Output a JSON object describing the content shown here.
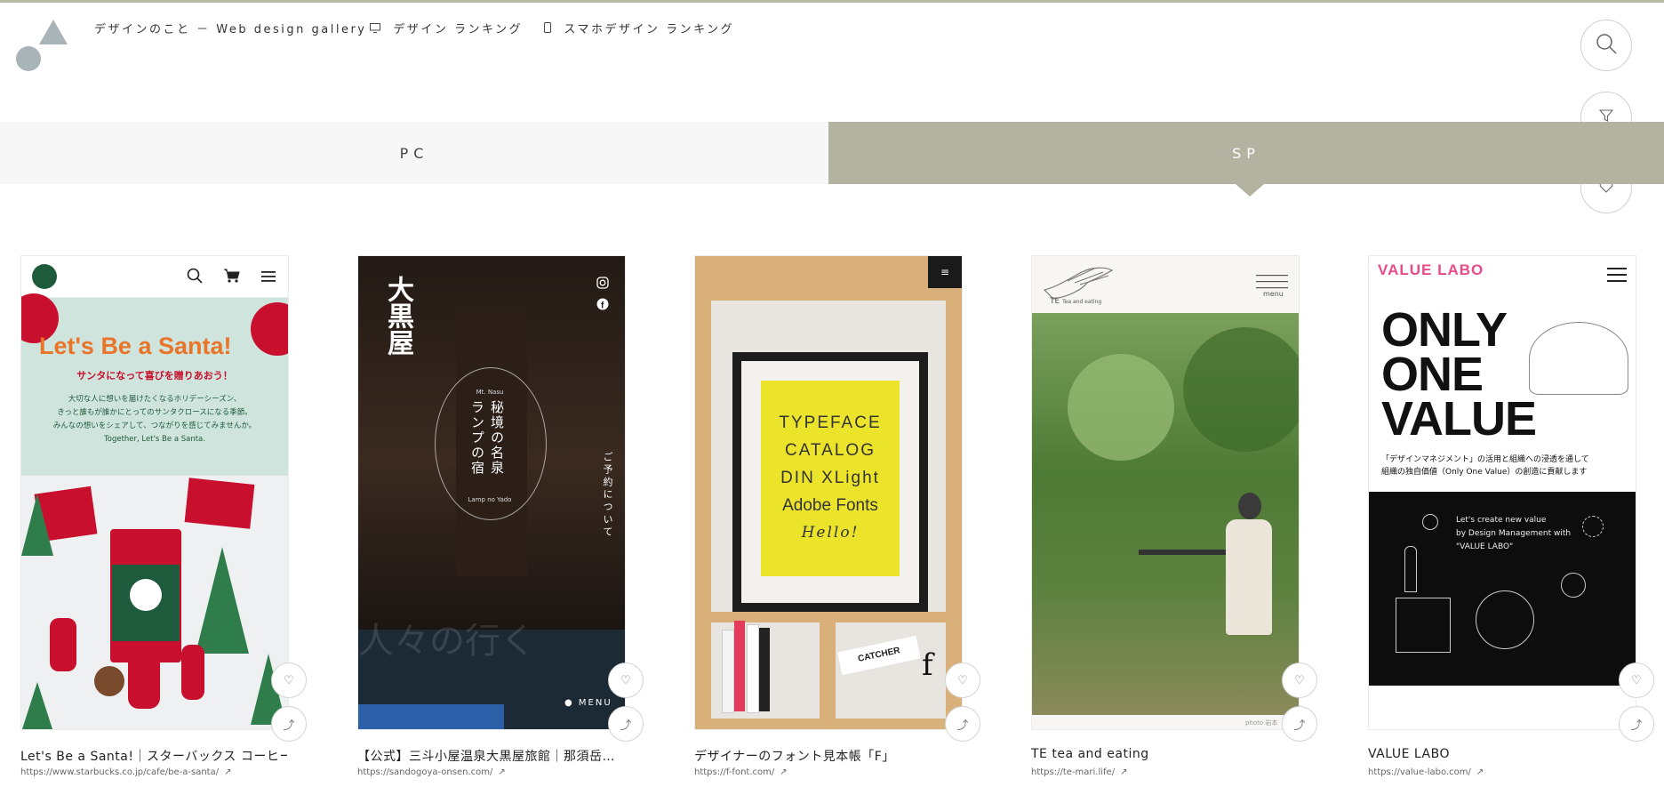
{
  "header": {
    "nav_home": "デザインのこと － Web design gallery",
    "nav_design_ranking": "デザイン ランキング",
    "nav_sp_ranking": "スマホデザイン ランキング"
  },
  "tabs": {
    "pc": "PC",
    "sp": "SP"
  },
  "cards": [
    {
      "title": "Let's Be a Santa!｜スターバックス コーヒー…",
      "url": "https://www.starbucks.co.jp/cafe/be-a-santa/",
      "shot": {
        "headline": "Let's Be a Santa!",
        "sub": "サンタになって喜びを贈りあおう！",
        "body1": "大切な人に想いを届けたくなるホリデーシーズン、",
        "body2": "きっと誰もが誰かにとってのサンタクロースになる季節。",
        "body3": "みんなの想いをシェアして、つながりを感じてみませんか。",
        "body4": "Together, Let's Be a Santa."
      }
    },
    {
      "title": "【公式】三斗小屋温泉大黒屋旅館｜那須岳…",
      "url": "https://sandogoya-onsen.com/",
      "shot": {
        "logo": "大黒屋",
        "mt": "Mt. Nasu",
        "col1": "秘境の名泉",
        "col2": "ランプの宿",
        "sub": "Lamp no Yado",
        "side": "ご予約について",
        "bottom": "人々の行く",
        "menu": "MENU"
      }
    },
    {
      "title": "デザイナーのフォント見本帳「F」",
      "url": "https://f-font.com/",
      "shot": {
        "line1": "TYPEFACE",
        "line2": "CATALOG",
        "line3": "DIN XLight",
        "line4": "Adobe Fonts",
        "line5": "Hello!",
        "book": "CATCHER"
      }
    },
    {
      "title": "TE tea and eating",
      "url": "https://te-mari.life/",
      "shot": {
        "brand": "TE",
        "tag": "Tea and eating",
        "menu": "menu",
        "credit": "photo 岩本"
      }
    },
    {
      "title": "VALUE LABO",
      "url": "https://value-labo.com/",
      "shot": {
        "logo": "VALUE LABO",
        "big1": "ONLY",
        "big2": "ONE",
        "big3": "VALUE",
        "jp1": "「デザインマネジメント」の活用と組織への浸透を通して",
        "jp2": "組織の独自価値（Only One Value）の創造に貢献します",
        "en1": "Let's create new value",
        "en2": "by Design Management with",
        "en3": "\"VALUE LABO\""
      }
    }
  ]
}
